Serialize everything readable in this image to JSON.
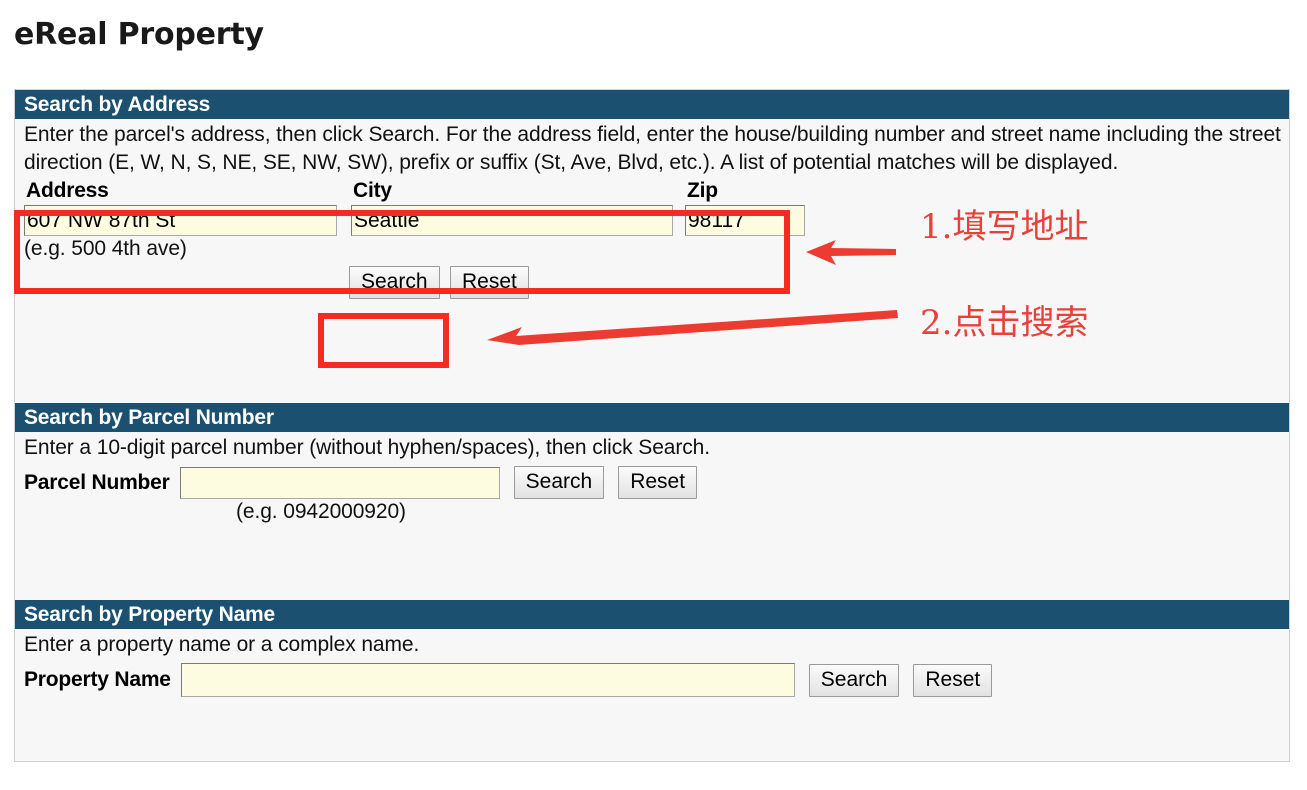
{
  "page": {
    "title": "eReal Property"
  },
  "sections": {
    "address": {
      "header": "Search by Address",
      "description": "Enter the parcel's address, then click Search.  For the address field, enter the house/building number and street name including the street direction (E, W, N, S, NE, SE, NW, SW), prefix or suffix (St, Ave, Blvd, etc.).  A list of potential matches will be displayed.",
      "columns": [
        "Address",
        "City",
        "Zip"
      ],
      "values": {
        "address": "607 NW 87th St",
        "city": "Seattle",
        "zip": "98117"
      },
      "hint": "(e.g. 500 4th ave)",
      "search_label": "Search",
      "reset_label": "Reset"
    },
    "parcel": {
      "header": "Search by Parcel Number",
      "description": "Enter a 10-digit parcel number (without hyphen/spaces), then click Search.",
      "label": "Parcel Number",
      "value": "",
      "hint": "(e.g. 0942000920)",
      "search_label": "Search",
      "reset_label": "Reset"
    },
    "property_name": {
      "header": "Search by Property Name",
      "description": "Enter a property name or a complex name.",
      "label": "Property Name",
      "value": "",
      "search_label": "Search",
      "reset_label": "Reset"
    }
  },
  "annotations": {
    "step1": "1.填写地址",
    "step2": "2.点击搜索",
    "color": "#e8413a",
    "box_color": "#f52a22"
  },
  "colors": {
    "header_bar": "#1b5070",
    "panel_bg": "#f7f7f7",
    "input_bg": "#fdfbe0"
  }
}
